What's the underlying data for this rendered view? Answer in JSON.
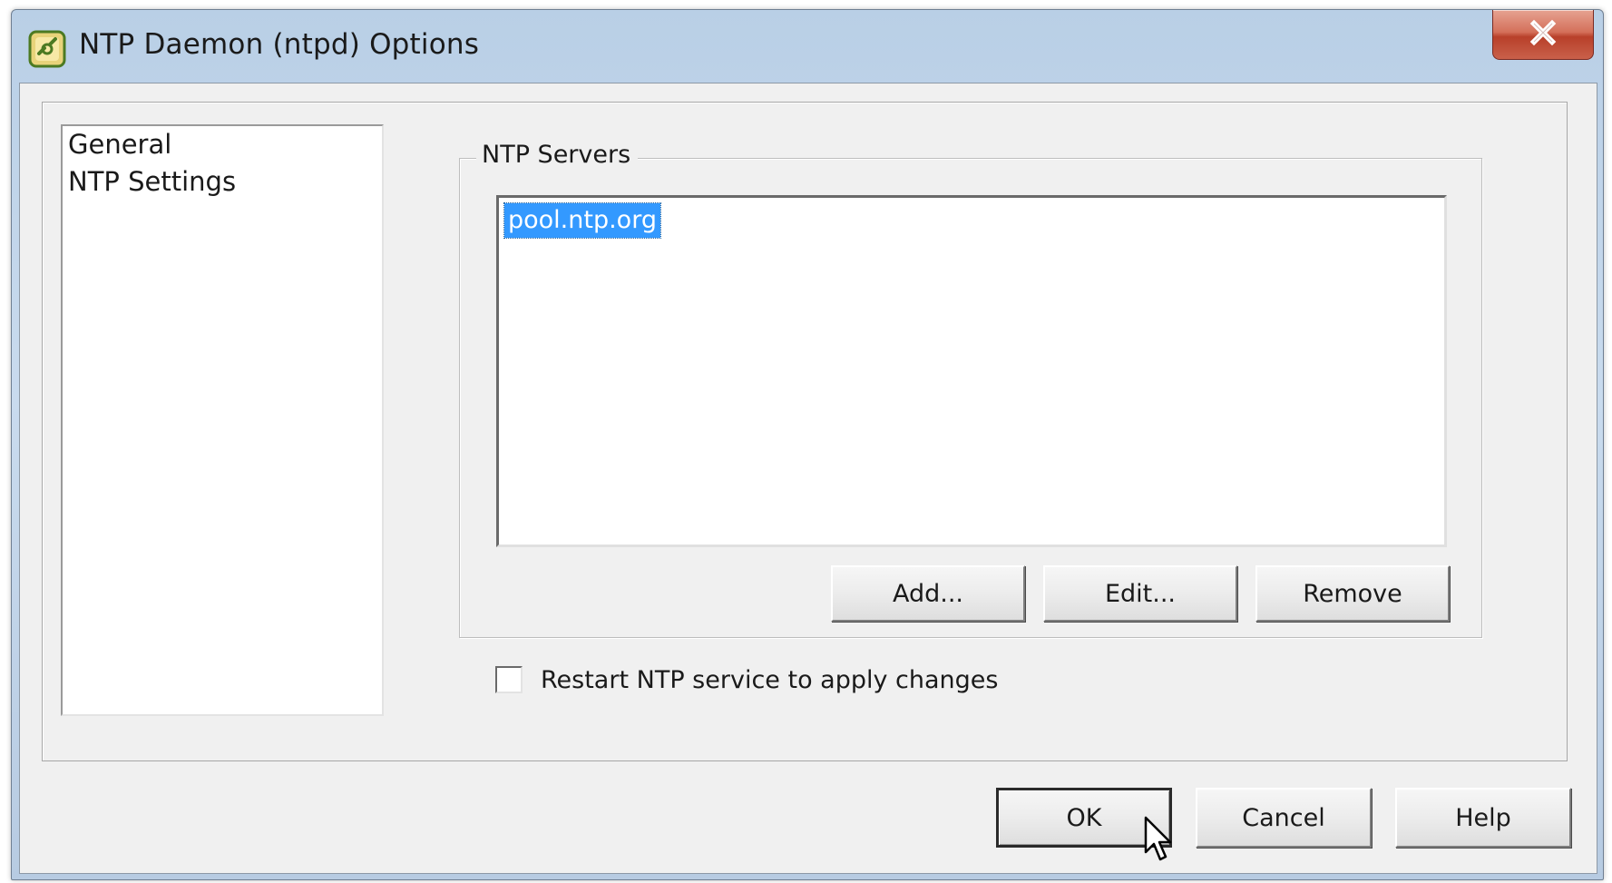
{
  "window": {
    "title": "NTP Daemon (ntpd) Options",
    "app_icon": "ntp-options-icon",
    "close_icon": "close-icon",
    "close_label": "X"
  },
  "nav": {
    "items": [
      {
        "label": "General"
      },
      {
        "label": "NTP Settings"
      }
    ]
  },
  "ntp_servers": {
    "group_title": "NTP Servers",
    "servers": [
      "pool.ntp.org"
    ],
    "selected_index": 0,
    "add_label": "Add...",
    "edit_label": "Edit...",
    "remove_label": "Remove"
  },
  "restart_option": {
    "label": "Restart NTP service to apply changes",
    "checked": false
  },
  "footer": {
    "ok_label": "OK",
    "cancel_label": "Cancel",
    "help_label": "Help"
  },
  "colors": {
    "selection": "#3399ff",
    "close_button": "#c9604a",
    "title_bar": "#c9dbee"
  }
}
